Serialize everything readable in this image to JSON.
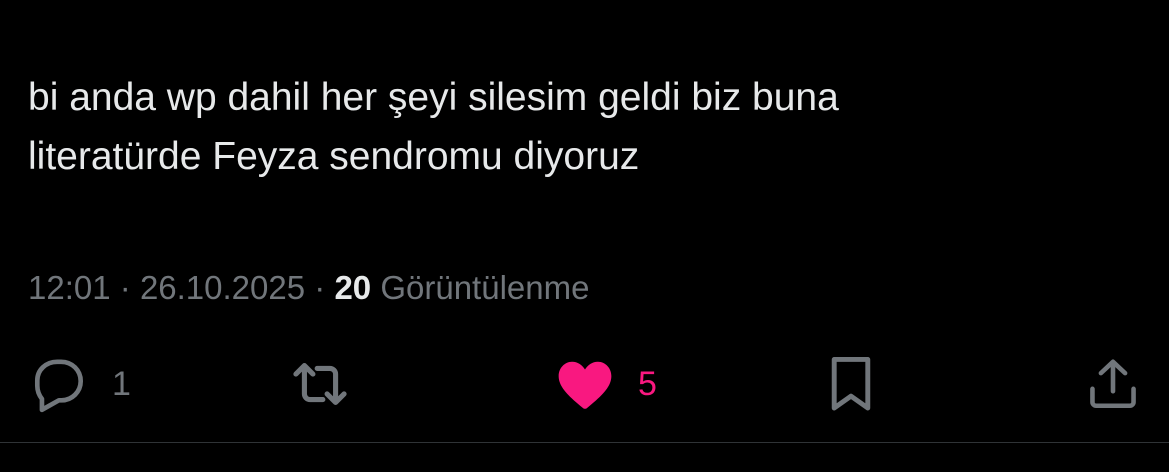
{
  "tweet": {
    "text": "bi anda wp dahil her şeyi silesim geldi biz buna\nliteratürde Feyza sendromu diyoruz",
    "time": "12:01",
    "date": "26.10.2025",
    "separator": "·",
    "views_count": "20",
    "views_label": "Görüntülenme"
  },
  "actions": {
    "reply": {
      "icon": "reply-icon",
      "count": "1"
    },
    "retweet": {
      "icon": "retweet-icon",
      "count": ""
    },
    "like": {
      "icon": "heart-icon",
      "count": "5",
      "liked": true
    },
    "bookmark": {
      "icon": "bookmark-icon"
    },
    "share": {
      "icon": "share-icon"
    }
  },
  "colors": {
    "background": "#000000",
    "text": "#e7e9ea",
    "muted": "#71767b",
    "like": "#f91880",
    "divider": "#2f3336"
  }
}
